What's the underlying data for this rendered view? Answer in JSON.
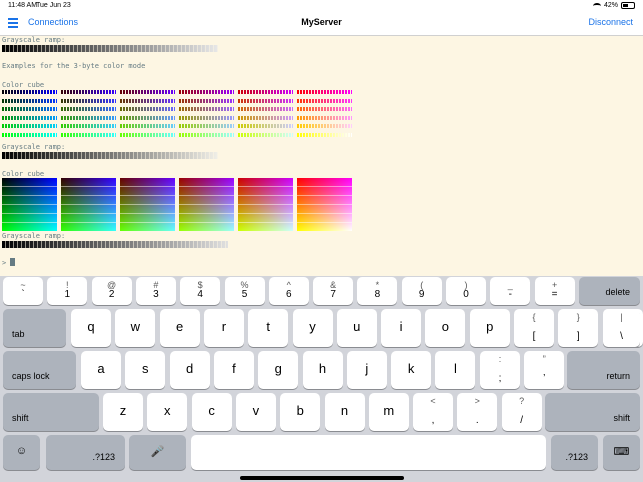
{
  "status": {
    "time": "11:48 AM",
    "date": "Tue Jun 23",
    "battery": "42%"
  },
  "nav": {
    "left_label": "Connections",
    "title": "MyServer",
    "right_label": "Disconnect"
  },
  "terminal": {
    "lines": [
      "Grayscale ramp:",
      "Examples for the 3-byte color mode",
      "Color cube",
      "Grayscale ramp:",
      "Color cube",
      "Grayscale ramp:",
      ">"
    ]
  },
  "keyboard": {
    "row1": [
      {
        "top": "~",
        "bot": "`"
      },
      {
        "top": "!",
        "bot": "1"
      },
      {
        "top": "@",
        "bot": "2"
      },
      {
        "top": "#",
        "bot": "3"
      },
      {
        "top": "$",
        "bot": "4"
      },
      {
        "top": "%",
        "bot": "5"
      },
      {
        "top": "^",
        "bot": "6"
      },
      {
        "top": "&",
        "bot": "7"
      },
      {
        "top": "*",
        "bot": "8"
      },
      {
        "top": "(",
        "bot": "9"
      },
      {
        "top": ")",
        "bot": "0"
      },
      {
        "top": "_",
        "bot": "-"
      },
      {
        "top": "+",
        "bot": "="
      }
    ],
    "delete": "delete",
    "tab": "tab",
    "row2": [
      "q",
      "w",
      "e",
      "r",
      "t",
      "y",
      "u",
      "i",
      "o",
      "p"
    ],
    "row2_punct": [
      {
        "top": "{",
        "bot": "["
      },
      {
        "top": "}",
        "bot": "]"
      },
      {
        "top": "|",
        "bot": "\\"
      }
    ],
    "caps": "caps lock",
    "row3": [
      "a",
      "s",
      "d",
      "f",
      "g",
      "h",
      "j",
      "k",
      "l"
    ],
    "row3_punct": [
      {
        "top": ":",
        "bot": ";"
      },
      {
        "top": "”",
        "bot": "’"
      }
    ],
    "return": "return",
    "shift_left": "shift",
    "row4": [
      "z",
      "x",
      "c",
      "v",
      "b",
      "n",
      "m"
    ],
    "row4_punct": [
      {
        "top": "<",
        "bot": ","
      },
      {
        "top": ">",
        "bot": "."
      },
      {
        "top": "?",
        "bot": "/"
      }
    ],
    "shift_right": "shift",
    "num_left": ".?123",
    "num_right": ".?123"
  }
}
